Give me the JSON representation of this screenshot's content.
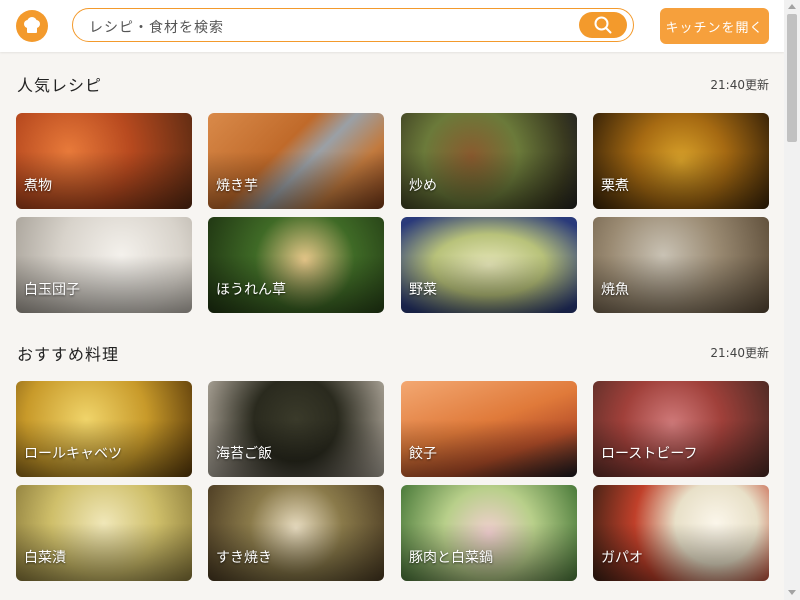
{
  "header": {
    "search_placeholder": "レシピ・食材を検索",
    "cta_label": "キッチンを開く"
  },
  "sections": [
    {
      "title": "人気レシピ",
      "time": "21:40更新",
      "cards": [
        {
          "label": "煮物"
        },
        {
          "label": "焼き芋"
        },
        {
          "label": "炒め"
        },
        {
          "label": "栗煮"
        },
        {
          "label": "白玉団子"
        },
        {
          "label": "ほうれん草"
        },
        {
          "label": "野菜"
        },
        {
          "label": "焼魚"
        }
      ]
    },
    {
      "title": "おすすめ料理",
      "time": "21:40更新",
      "cards": [
        {
          "label": "ロールキャベツ"
        },
        {
          "label": "海苔ご飯"
        },
        {
          "label": "餃子"
        },
        {
          "label": "ローストビーフ"
        },
        {
          "label": "白菜漬"
        },
        {
          "label": "すき焼き"
        },
        {
          "label": "豚肉と白菜鍋"
        },
        {
          "label": "ガパオ"
        }
      ]
    }
  ]
}
